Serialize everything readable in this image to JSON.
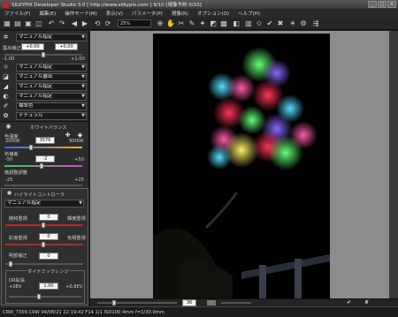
{
  "window": {
    "title": "SILKYPIX Developer Studio 3.0 [ http://www.silkypix.com ]  9/10 [現像予約 0/10]"
  },
  "menu": [
    "ファイル(F)",
    "編集(E)",
    "操作モード(M)",
    "表示(V)",
    "パラメータ(P)",
    "現像(R)",
    "オプション(O)",
    "ヘルプ(H)"
  ],
  "toolbar": {
    "zoom": "25%"
  },
  "panel": {
    "taste_preset": "マニュアル指定",
    "exposure_label": "露出補正",
    "exposure_left": "+0.00",
    "exposure_right": "+0.00",
    "exposure_min": "-1.00",
    "exposure_max": "+1.00",
    "wb_preset": "マニュアル指定",
    "exposure_mode": "マニュアル露出",
    "tone_preset": "マニュアル指定",
    "contrast_preset": "マニュアル指定",
    "color_preset": "標準色",
    "style_preset": "ナチュラル",
    "wb_title": "ホワイトバランス",
    "temp_label": "色温度",
    "temp_value": "3576",
    "temp_min": "2000K",
    "temp_max": "9000K",
    "tint_label": "色偏差",
    "tint_value": "-2",
    "tint_min": "-50",
    "tint_max": "+50",
    "fine_label": "微調整調整",
    "fine_min": "-25",
    "fine_max": "+25",
    "hl_title": "ハイライトコントローラ",
    "hl_preset": "マニュアル指定",
    "hl_sat_label": "飽和重視",
    "hl_sat_value": "0",
    "hl_sat_right": "輝度重視",
    "hl_hue_label": "彩度重視",
    "hl_hue_value": "0",
    "hl_hue_right": "色相重視",
    "hl_bright_label": "明部補正",
    "hl_bright_value": "0",
    "dr_title": "ダイナミックレンジ",
    "dr_label": "DR拡張",
    "dr_value": "1.00",
    "dr_min": "+0EV",
    "dr_max": "+0.8EV"
  },
  "status": {
    "file": "CRW_7309.CRW 04/08/21 22:19:42 F14 1/1 ISO100 4mm  f=1/30.0mm",
    "page": "36"
  },
  "colors": {
    "accent": "#d02a2a",
    "background": "#1e1e1e",
    "canvas": "#8c8c8c"
  }
}
